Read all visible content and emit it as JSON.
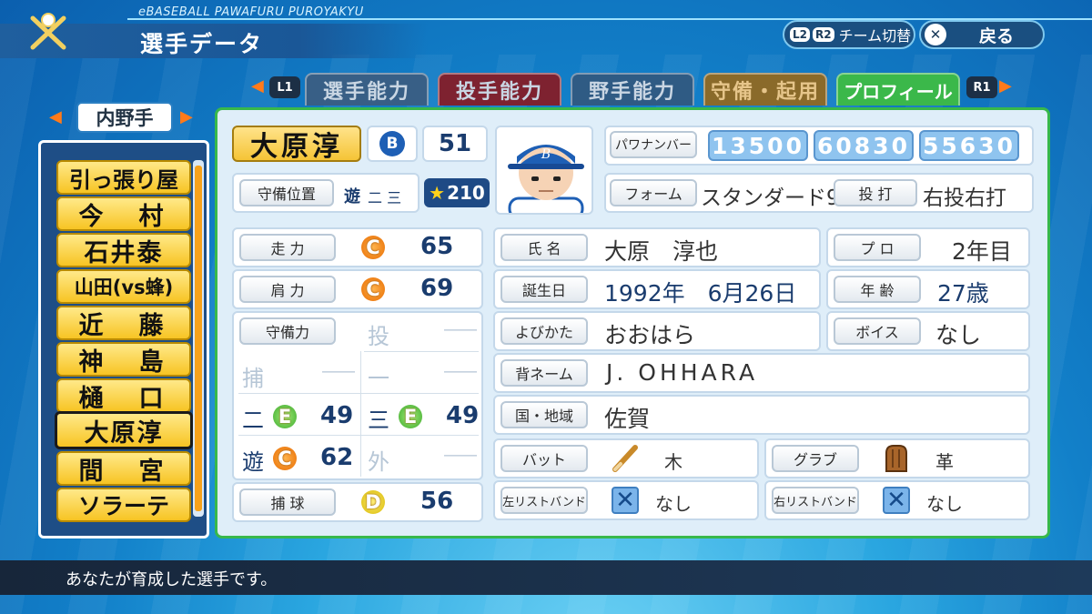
{
  "header": {
    "brand": "eBASEBALL PAWAFURU PUROYAKYU",
    "title": "選手データ",
    "team_switch": {
      "l2": "L2",
      "r2": "R2",
      "label": "チーム切替"
    },
    "back": {
      "icon": "✕",
      "label": "戻る"
    }
  },
  "tabs": {
    "l1": "L1",
    "r1": "R1",
    "items": [
      "選手能力",
      "投手能力",
      "野手能力",
      "守備・起用",
      "プロフィール"
    ]
  },
  "position_filter": "内野手",
  "players": [
    "引っ張り屋",
    "今　村",
    "石井泰",
    "山田(vs蜂)",
    "近　藤",
    "神　島",
    "樋　口",
    "大原淳",
    "間　宮",
    "ソラーテ"
  ],
  "profile": {
    "name": "大原淳",
    "team_logo": "B",
    "number": "51",
    "position_label": "守備位置",
    "position_value": "遊",
    "position_sub": "二 三",
    "stars": "210",
    "pawa_label": "パワナンバー",
    "pawa_numbers": [
      "13500",
      "60830",
      "55630"
    ],
    "form_label": "フォーム",
    "form_value": "スタンダード9",
    "throw_label": "投 打",
    "throw_value": "右投右打",
    "speed_label": "走 力",
    "speed_grade": "C",
    "speed_value": "65",
    "arm_label": "肩 力",
    "arm_grade": "C",
    "arm_value": "69",
    "defense_label": "守備力",
    "defense": {
      "p_label": "投",
      "p_value": "――",
      "c_label": "捕",
      "c_value": "――",
      "first_label": "一",
      "first_value": "――",
      "second_label": "二",
      "second_grade": "E",
      "second_value": "49",
      "third_label": "三",
      "third_grade": "E",
      "third_value": "49",
      "ss_label": "遊",
      "ss_grade": "C",
      "ss_value": "62",
      "of_label": "外",
      "of_value": "――"
    },
    "catch_label": "捕 球",
    "catch_grade": "D",
    "catch_value": "56",
    "fullname_label": "氏 名",
    "fullname_value": "大原　淳也",
    "pro_label": "プ ロ",
    "pro_value": "2年目",
    "birth_label": "誕生日",
    "birth_value": "1992年　6月26日",
    "age_label": "年 齢",
    "age_value": "27歳",
    "yomi_label": "よびかた",
    "yomi_value": "おおはら",
    "voice_label": "ボイス",
    "voice_value": "なし",
    "back_name_label": "背ネーム",
    "back_name_value": "J. OHHARA",
    "region_label": "国・地域",
    "region_value": "佐賀",
    "bat_label": "バット",
    "bat_value": "木",
    "glove_label": "グラブ",
    "glove_value": "革",
    "lwrist_label": "左リストバンド",
    "lwrist_value": "なし",
    "rwrist_label": "右リストバンド",
    "rwrist_value": "なし"
  },
  "message": "あなたが育成した選手です。",
  "colors": {
    "tab_active": "#3bb84a",
    "accent": "#f7a21a",
    "grade_c": "#e86b00",
    "grade_e": "#3aa82c",
    "grade_d": "#d8b800"
  }
}
